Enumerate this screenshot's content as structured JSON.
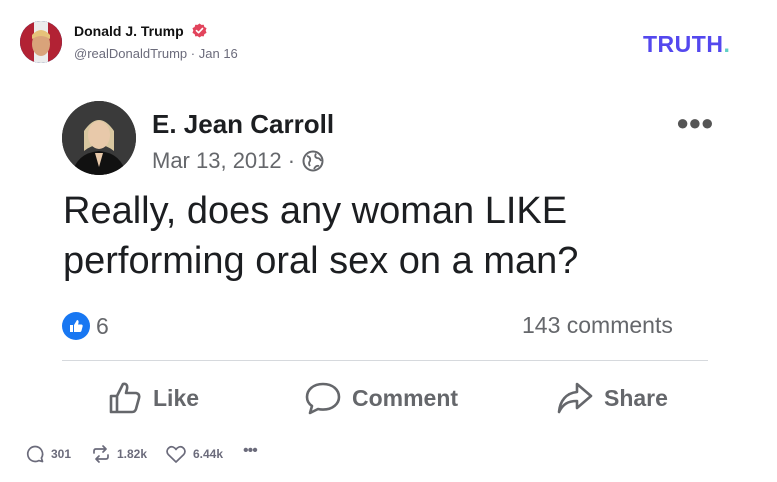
{
  "post": {
    "author_name": "Donald J. Trump",
    "handle": "@realDonaldTrump",
    "separator": "·",
    "date": "Jan 16",
    "logo_text": "TRUTH",
    "logo_dot": "."
  },
  "embedded": {
    "name": "E. Jean Carroll",
    "date": "Mar 13, 2012 ·",
    "text": "Really, does any woman LIKE performing oral sex on a man?",
    "like_count": "6",
    "comments": "143 comments",
    "actions": {
      "like": "Like",
      "comment": "Comment",
      "share": "Share"
    }
  },
  "footer": {
    "replies": "301",
    "retruths": "1.82k",
    "likes": "6.44k"
  },
  "colors": {
    "brand": "#5448ee",
    "brand_dot": "#5fd0c6",
    "verified": "#e2445c",
    "facebook_blue": "#1877f2"
  },
  "icons": [
    "verified-badge-icon",
    "more-icon",
    "globe-icon",
    "like-reaction-icon",
    "thumbs-up-icon",
    "comment-icon",
    "share-icon",
    "reply-icon",
    "retruth-icon",
    "heart-icon"
  ]
}
